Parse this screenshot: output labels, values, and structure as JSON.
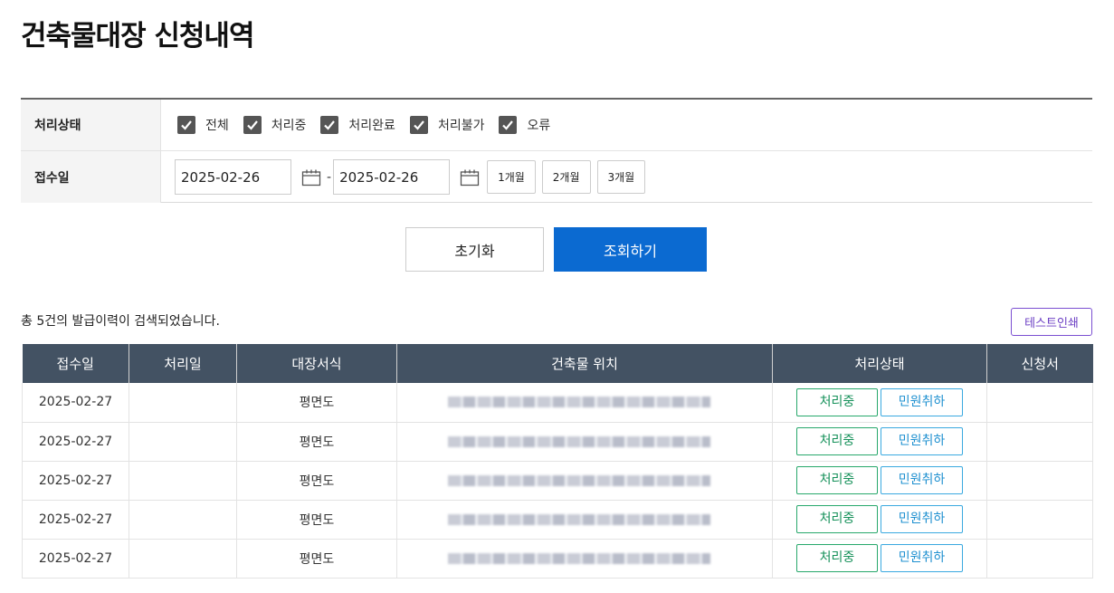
{
  "page": {
    "title": "건축물대장 신청내역"
  },
  "filter": {
    "status_label": "처리상태",
    "status_options": [
      {
        "label": "전체",
        "checked": true
      },
      {
        "label": "처리중",
        "checked": true
      },
      {
        "label": "처리완료",
        "checked": true
      },
      {
        "label": "처리불가",
        "checked": true
      },
      {
        "label": "오류",
        "checked": true
      }
    ],
    "date_label": "접수일",
    "date_from": "2025-02-26",
    "date_separator": "-",
    "date_to": "2025-02-26",
    "period_buttons": [
      "1개월",
      "2개월",
      "3개월"
    ]
  },
  "actions": {
    "reset_label": "초기화",
    "search_label": "조회하기"
  },
  "result": {
    "summary": "총 5건의 발급이력이 검색되었습니다.",
    "test_print_label": "테스트인쇄"
  },
  "table": {
    "headers": [
      "접수일",
      "처리일",
      "대장서식",
      "건축물 위치",
      "처리상태",
      "신청서"
    ],
    "rows": [
      {
        "received": "2025-02-27",
        "processed": "",
        "form": "평면도",
        "status": "처리중",
        "cancel": "민원취하"
      },
      {
        "received": "2025-02-27",
        "processed": "",
        "form": "평면도",
        "status": "처리중",
        "cancel": "민원취하"
      },
      {
        "received": "2025-02-27",
        "processed": "",
        "form": "평면도",
        "status": "처리중",
        "cancel": "민원취하"
      },
      {
        "received": "2025-02-27",
        "processed": "",
        "form": "평면도",
        "status": "처리중",
        "cancel": "민원취하"
      },
      {
        "received": "2025-02-27",
        "processed": "",
        "form": "평면도",
        "status": "처리중",
        "cancel": "민원취하"
      }
    ]
  },
  "colors": {
    "header_bg": "#435263",
    "primary": "#0b6ad1",
    "status_green": "#27a86b",
    "cancel_blue": "#3aa9e0",
    "test_purple": "#7b4fd1"
  },
  "icons": {
    "checkbox": "check-icon",
    "calendar": "calendar-icon"
  }
}
